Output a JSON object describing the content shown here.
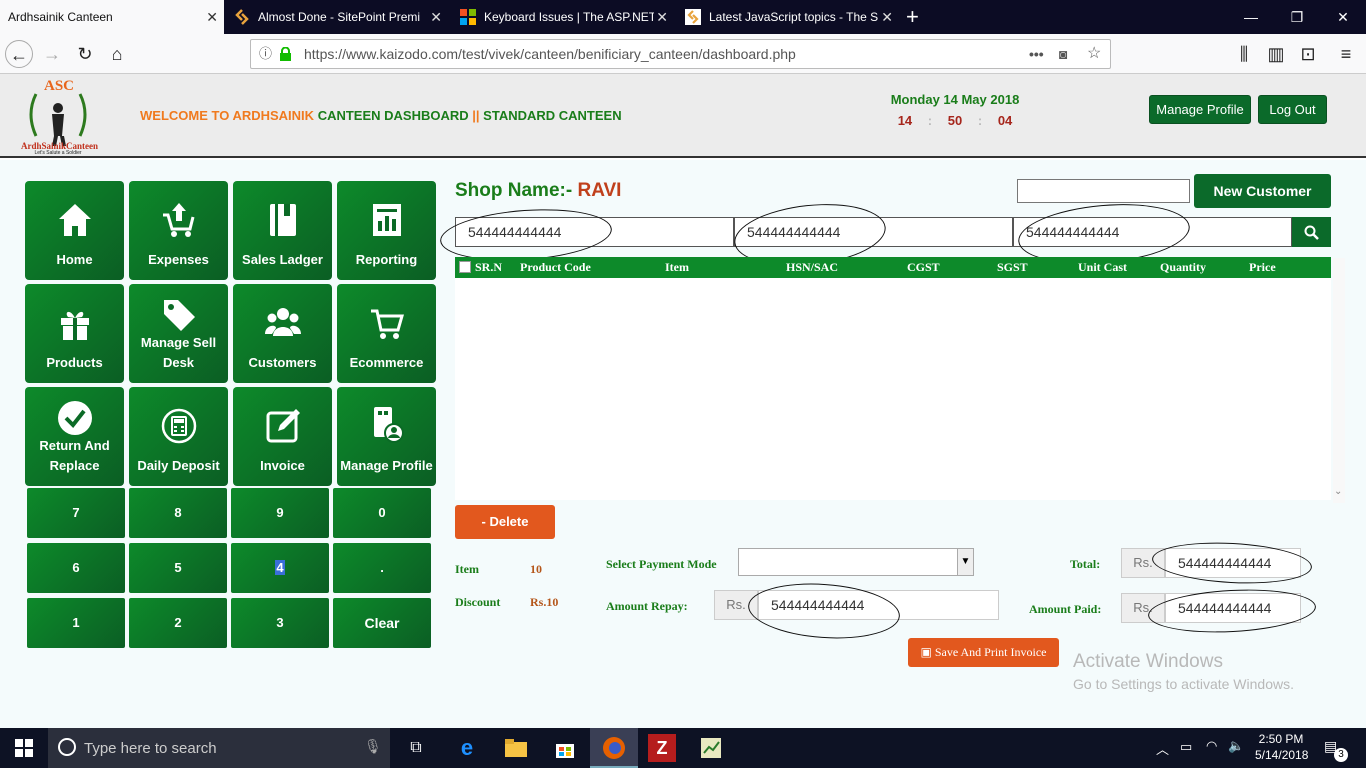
{
  "browser": {
    "tabs": [
      {
        "title": "Ardhsainik Canteen",
        "active": true
      },
      {
        "title": "Almost Done - SitePoint Premi",
        "active": false
      },
      {
        "title": "Keyboard Issues | The ASP.NET",
        "active": false
      },
      {
        "title": "Latest JavaScript topics - The Si",
        "active": false
      }
    ],
    "url": "https://www.kaizodo.com/test/vivek/canteen/benificiary_canteen/dashboard.php"
  },
  "header": {
    "logo_text": "ASC",
    "logo_sub": "ArdhSainikCanteen",
    "logo_tagline": "Let's Salute a Soldier",
    "welcome_part1": "WELCOME TO ARDHSAINIK",
    "welcome_part2": "CANTEEN DASHBOARD",
    "welcome_sep": "||",
    "welcome_part3": "STANDARD CANTEEN",
    "date": "Monday 14 May 2018",
    "hour": "14",
    "minute": "50",
    "second": "04",
    "clock_sep": ":",
    "manage_profile": "Manage Profile",
    "logout": "Log Out"
  },
  "tiles": [
    {
      "label": "Home",
      "icon": "home-icon"
    },
    {
      "label": "Expenses",
      "icon": "cart-upload-icon"
    },
    {
      "label": "Sales Ladger",
      "icon": "book-icon"
    },
    {
      "label": "Reporting",
      "icon": "report-icon"
    },
    {
      "label": "Products",
      "icon": "gift-icon"
    },
    {
      "label": "Manage Sell Desk",
      "icon": "tag-icon"
    },
    {
      "label": "Customers",
      "icon": "users-icon"
    },
    {
      "label": "Ecommerce",
      "icon": "shopping-cart-icon"
    },
    {
      "label": "Return And Replace",
      "icon": "check-circle-icon"
    },
    {
      "label": "Daily Deposit",
      "icon": "calculator-icon"
    },
    {
      "label": "Invoice",
      "icon": "edit-icon"
    },
    {
      "label": "Manage Profile",
      "icon": "profile-icon"
    }
  ],
  "keypad": [
    "7",
    "8",
    "9",
    "0",
    "6",
    "5",
    "4",
    ".",
    "1",
    "2",
    "3",
    "Clear"
  ],
  "shop": {
    "prefix": "Shop Name:-",
    "name": "RAVI"
  },
  "new_customer": "New Customer",
  "search_fields": [
    "544444444444",
    "544444444444",
    "544444444444"
  ],
  "table_headers": [
    "SR.N",
    "Product Code",
    "Item",
    "HSN/SAC",
    "CGST",
    "SGST",
    "Unit Cast",
    "Quantity",
    "Price"
  ],
  "delete_label": "- Delete",
  "summary": {
    "item_label": "Item",
    "item_value": "10",
    "discount_label": "Discount",
    "discount_value": "Rs.10",
    "payment_mode_label": "Select Payment Mode",
    "amount_repay_label": "Amount Repay:",
    "amount_repay_value": "544444444444",
    "total_label": "Total:",
    "total_value": "544444444444",
    "amount_paid_label": "Amount Paid:",
    "amount_paid_value": "544444444444",
    "currency": "Rs."
  },
  "save_print": "Save And Print Invoice",
  "watermark": {
    "line1": "Activate Windows",
    "line2": "Go to Settings to activate Windows."
  },
  "taskbar": {
    "search_placeholder": "Type here to search",
    "time": "2:50 PM",
    "date": "5/14/2018",
    "notifications": "3"
  }
}
